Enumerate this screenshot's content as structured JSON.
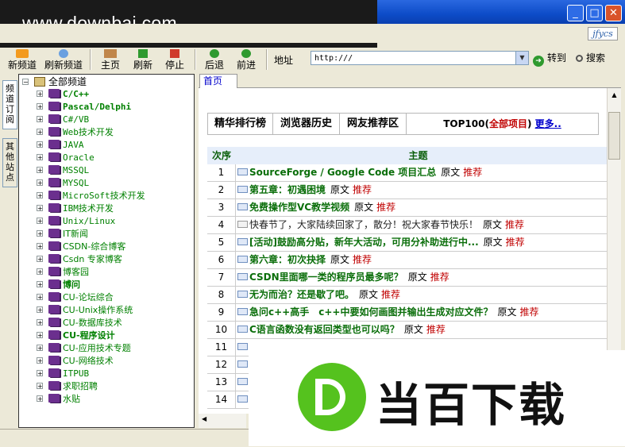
{
  "watermark": {
    "site": "www.downbai.com",
    "brand": "当百下载"
  },
  "window": {
    "logo": "jfycs",
    "min": "_",
    "max": "□",
    "close": "✕"
  },
  "toolbar": {
    "new_channel": "新频道",
    "refresh_channel": "刷新频道",
    "home": "主页",
    "refresh": "刷新",
    "stop": "停止",
    "back": "后退",
    "forward": "前进",
    "address_label": "地址",
    "address_value": "http:///",
    "go": "转到",
    "search": "搜索"
  },
  "side_tabs": {
    "subscribe": "频道订阅",
    "other_sites": "其他站点"
  },
  "tree": {
    "root": "全部频道",
    "items": [
      "C/C++",
      "Pascal/Delphi",
      "C#/VB",
      "Web技术开发",
      "JAVA",
      "Oracle",
      "MSSQL",
      "MYSQL",
      "MicroSoft技术开发",
      "IBM技术开发",
      "Unix/Linux",
      "IT新闻",
      "CSDN-综合博客",
      "Csdn 专家博客",
      "博客园",
      "博问",
      "CU-论坛综合",
      "CU-Unix操作系统",
      "CU-数据库技术",
      "CU-程序设计",
      "CU-应用技术专题",
      "CU-网络技术",
      "ITPUB",
      "求职招聘",
      "水贴"
    ]
  },
  "content_tab": "首页",
  "segments": {
    "hot": "精华排行榜",
    "history": "浏览器历史",
    "recommend": "网友推荐区",
    "top_prefix": "TOP100(",
    "top_red": "全部项目",
    "top_suffix": ")",
    "more": "更多.."
  },
  "table": {
    "col_num": "次序",
    "col_title": "主题",
    "original": "原文",
    "recommend": "推荐",
    "rows": [
      {
        "num": "1",
        "title": "SourceForge / Google Code 项目汇总"
      },
      {
        "num": "2",
        "title": "第五章：初遇困境"
      },
      {
        "num": "3",
        "title": "免费操作型VC教学视频"
      },
      {
        "num": "4",
        "title": "快春节了，大家陆续回家了，散分！祝大家春节快乐！"
      },
      {
        "num": "5",
        "title": "[活动]鼓励高分贴，新年大活动，可用分补助进行中..."
      },
      {
        "num": "6",
        "title": "第六章：初次抉择"
      },
      {
        "num": "7",
        "title": "CSDN里面哪一类的程序员最多呢？"
      },
      {
        "num": "8",
        "title": "无为而治？还是歇了吧。"
      },
      {
        "num": "9",
        "title": "急问c++高手　c++中要如何画图并输出生成对应文件？"
      },
      {
        "num": "10",
        "title": "C语言函数没有返回类型也可以吗？"
      },
      {
        "num": "11",
        "title": ""
      },
      {
        "num": "12",
        "title": ""
      },
      {
        "num": "13",
        "title": ""
      },
      {
        "num": "14",
        "title": ""
      }
    ]
  }
}
